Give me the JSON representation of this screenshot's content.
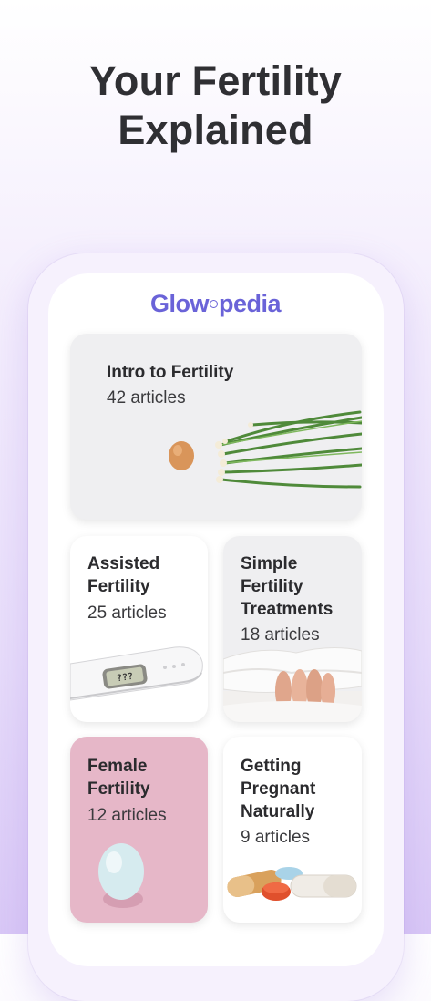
{
  "headline": {
    "line1": "Your Fertility",
    "line2": "Explained"
  },
  "logo": {
    "part1": "Glow",
    "part2": "pedia"
  },
  "cards": [
    {
      "title": "Intro to Fertility",
      "count": "42 articles",
      "image_icon": "egg-and-sprouts-icon"
    },
    {
      "title": "Assisted Fertility",
      "count": "25 articles",
      "image_icon": "pregnancy-test-icon",
      "test_display": "???"
    },
    {
      "title": "Simple Fertility Treatments",
      "count": "18 articles",
      "image_icon": "feet-under-sheets-icon"
    },
    {
      "title": "Female Fertility",
      "count": "12 articles",
      "image_icon": "egg-icon"
    },
    {
      "title": "Getting Pregnant Naturally",
      "count": "9 articles",
      "image_icon": "pills-icon"
    }
  ],
  "colors": {
    "brand": "#6a63d8",
    "female_card": "#e6b7c8",
    "background_gradient_end": "#d9c8f6"
  }
}
